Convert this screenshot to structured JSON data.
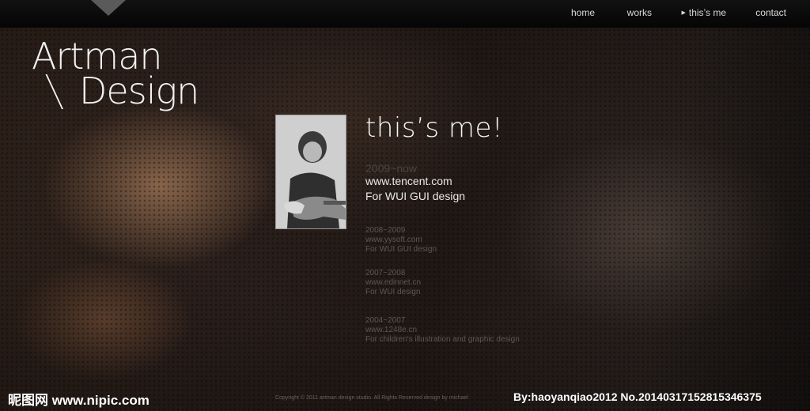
{
  "nav": {
    "items": [
      {
        "label": "home"
      },
      {
        "label": "works"
      },
      {
        "label": "this’s me",
        "active": true
      },
      {
        "label": "contact"
      }
    ]
  },
  "logo": {
    "line1": "Artman",
    "line2": "Design"
  },
  "heading": "this’s me!",
  "current_job": {
    "years": "2009~now",
    "site": "www.tencent.com",
    "desc": "For WUI GUI design"
  },
  "past_jobs": [
    {
      "years": "2008~2009",
      "site": "www.yysoft.com",
      "desc": "For WUI GUI design"
    },
    {
      "years": "2007~2008",
      "site": "www.edinnet.cn",
      "desc": "For WUI design"
    },
    {
      "years": "2004~2007",
      "site": "www.1248e.cn",
      "desc": "For children's illustration and graphic design"
    }
  ],
  "footer": {
    "copyright": "Copyright © 2011 artman design studio. All Rights Reserved  design by michael"
  },
  "watermark": {
    "left": "昵图网 www.nipic.com",
    "right": "By:haoyanqiao2012  No.20140317152815346375"
  },
  "colors": {
    "accent_text": "#f5f5f5",
    "muted_text": "#5f5651",
    "topbar": "#080808"
  }
}
